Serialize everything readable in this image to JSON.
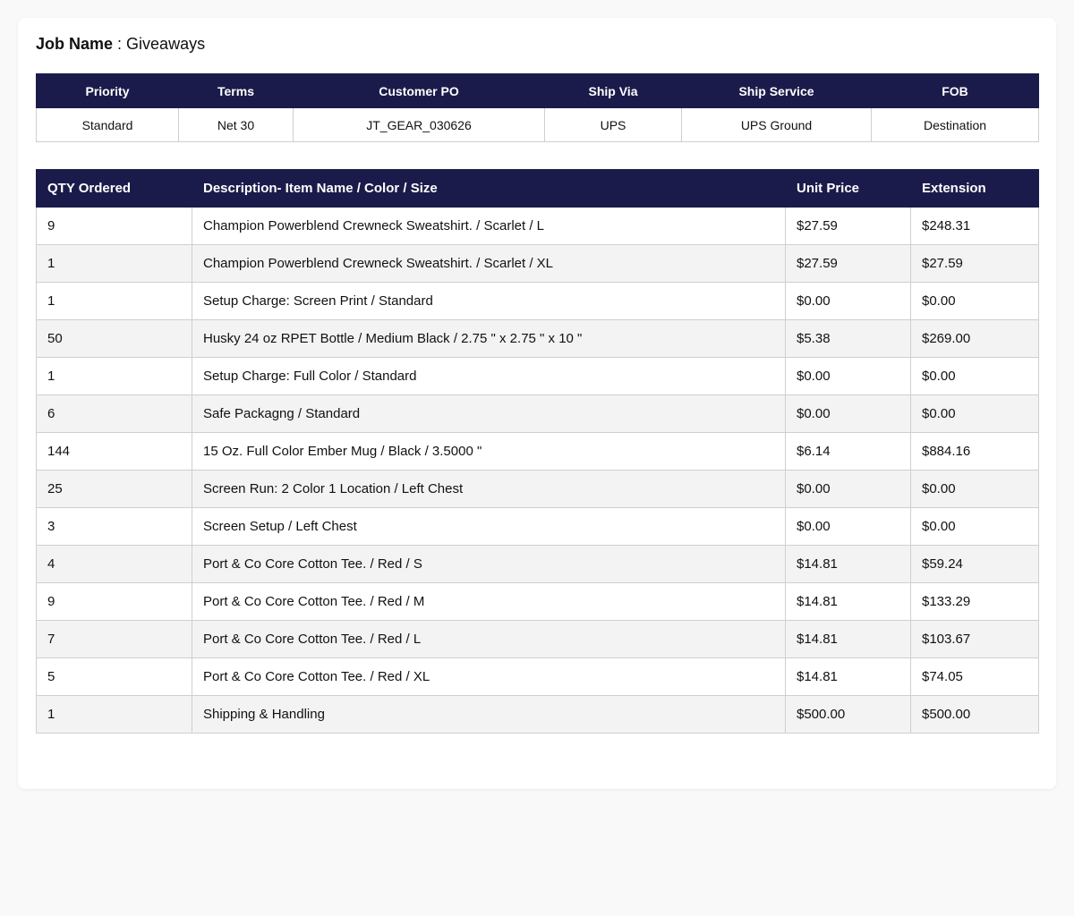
{
  "job": {
    "label": "Job Name",
    "separator": " : ",
    "value": "Giveaways"
  },
  "info_table": {
    "headers": [
      "Priority",
      "Terms",
      "Customer PO",
      "Ship Via",
      "Ship Service",
      "FOB"
    ],
    "values": [
      "Standard",
      "Net 30",
      "JT_GEAR_030626",
      "UPS",
      "UPS Ground",
      "Destination"
    ]
  },
  "items_table": {
    "headers": [
      "QTY Ordered",
      "Description- Item Name / Color / Size",
      "Unit Price",
      "Extension"
    ],
    "rows": [
      {
        "qty": "9",
        "desc": "Champion Powerblend Crewneck Sweatshirt. / Scarlet / L",
        "unit": "$27.59",
        "ext": "$248.31"
      },
      {
        "qty": "1",
        "desc": "Champion Powerblend Crewneck Sweatshirt. / Scarlet / XL",
        "unit": "$27.59",
        "ext": "$27.59"
      },
      {
        "qty": "1",
        "desc": "Setup Charge: Screen Print / Standard",
        "unit": "$0.00",
        "ext": "$0.00"
      },
      {
        "qty": "50",
        "desc": "Husky 24 oz RPET Bottle / Medium Black / 2.75 \" x 2.75 \" x 10 \"",
        "unit": "$5.38",
        "ext": "$269.00"
      },
      {
        "qty": "1",
        "desc": "Setup Charge: Full Color / Standard",
        "unit": "$0.00",
        "ext": "$0.00"
      },
      {
        "qty": "6",
        "desc": "Safe Packagng / Standard",
        "unit": "$0.00",
        "ext": "$0.00"
      },
      {
        "qty": "144",
        "desc": "15 Oz. Full Color Ember Mug / Black / 3.5000 \"",
        "unit": "$6.14",
        "ext": "$884.16"
      },
      {
        "qty": "25",
        "desc": "Screen Run: 2 Color 1 Location / Left Chest",
        "unit": "$0.00",
        "ext": "$0.00"
      },
      {
        "qty": "3",
        "desc": "Screen Setup / Left Chest",
        "unit": "$0.00",
        "ext": "$0.00"
      },
      {
        "qty": "4",
        "desc": "Port & Co Core Cotton Tee. / Red / S",
        "unit": "$14.81",
        "ext": "$59.24"
      },
      {
        "qty": "9",
        "desc": "Port & Co Core Cotton Tee. / Red / M",
        "unit": "$14.81",
        "ext": "$133.29"
      },
      {
        "qty": "7",
        "desc": "Port & Co Core Cotton Tee. / Red / L",
        "unit": "$14.81",
        "ext": "$103.67"
      },
      {
        "qty": "5",
        "desc": "Port & Co Core Cotton Tee. / Red / XL",
        "unit": "$14.81",
        "ext": "$74.05"
      },
      {
        "qty": "1",
        "desc": "Shipping & Handling",
        "unit": "$500.00",
        "ext": "$500.00"
      }
    ]
  },
  "colors": {
    "header_bg": "#1b1b4b",
    "header_text": "#ffffff",
    "alt_row_bg": "#f3f3f3",
    "border": "#cfcfcf"
  }
}
